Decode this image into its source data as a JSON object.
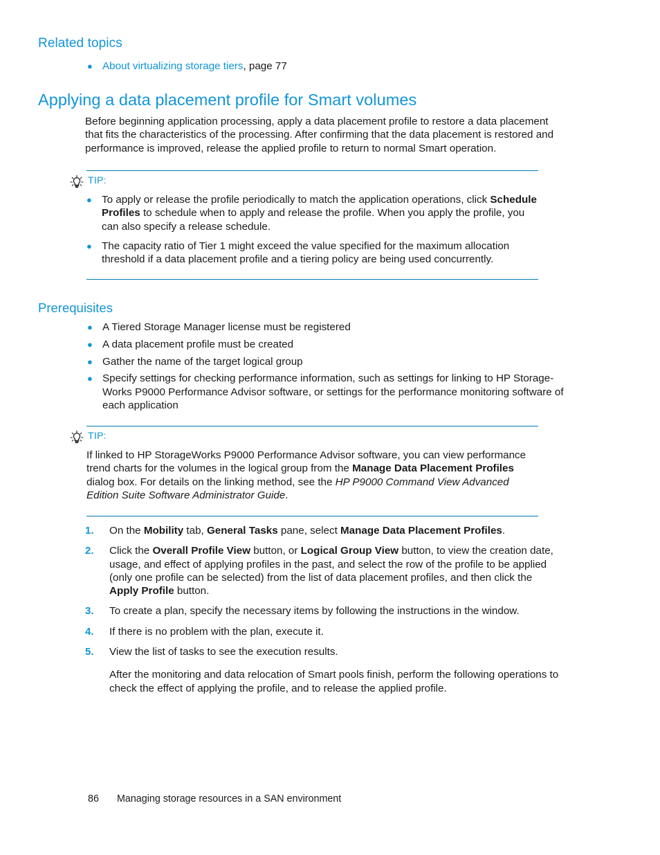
{
  "colors": {
    "heading_blue": "#1295d8",
    "rule_blue": "#0079b4",
    "body_black": "#1a1a1a"
  },
  "related_topics": {
    "heading": "Related topics",
    "items": [
      {
        "link_text": "About virtualizing storage tiers",
        "suffix": ", page 77"
      }
    ]
  },
  "section": {
    "title": "Applying a data placement profile for Smart volumes",
    "intro": "Before beginning application processing, apply a data placement profile to restore a data placement that fits the characteristics of the processing. After confirming that the data placement is restored and performance is improved, release the applied profile to return to normal Smart operation."
  },
  "tip_1": {
    "icon": "lightbulb-icon",
    "label": "TIP:",
    "bullets": [
      {
        "part1": "To apply or release the profile periodically to match the application operations, click ",
        "bold1": "Schedule Profiles",
        "part2": " to schedule when to apply and release the profile. When you apply the profile, you can also specify a release schedule."
      },
      {
        "part1": "The capacity ratio of Tier 1 might exceed the value specified for the maximum allocation threshold if a data placement profile and a tiering policy are being used concurrently.",
        "bold1": "",
        "part2": ""
      }
    ]
  },
  "prerequisites": {
    "heading": "Prerequisites",
    "items": [
      "A Tiered Storage Manager license must be registered",
      "A data placement profile must be created",
      "Gather the name of the target logical group",
      "Specify settings for checking performance information, such as settings for linking to HP Storage-Works P9000 Performance Advisor software, or settings for the performance monitoring software of each application"
    ]
  },
  "tip_2": {
    "icon": "lightbulb-icon",
    "label": "TIP:",
    "paragraph": {
      "part1": "If linked to HP StorageWorks P9000 Performance Advisor software, you can view performance trend charts for the volumes in the logical group from the ",
      "bold1": "Manage Data Placement Profiles",
      "part2": " dialog box. For details on the linking method, see the ",
      "italic1": "HP P9000 Command View Advanced Edition Suite Software Administrator Guide",
      "part3": "."
    }
  },
  "steps": {
    "items": [
      {
        "number": "1.",
        "segments": [
          {
            "text": "On the ",
            "style": "normal"
          },
          {
            "text": "Mobility",
            "style": "bold"
          },
          {
            "text": " tab, ",
            "style": "normal"
          },
          {
            "text": "General Tasks",
            "style": "bold"
          },
          {
            "text": " pane, select ",
            "style": "normal"
          },
          {
            "text": "Manage Data Placement Profiles",
            "style": "bold"
          },
          {
            "text": ".",
            "style": "normal"
          }
        ]
      },
      {
        "number": "2.",
        "segments": [
          {
            "text": "Click the ",
            "style": "normal"
          },
          {
            "text": "Overall Profile View",
            "style": "bold"
          },
          {
            "text": " button, or ",
            "style": "normal"
          },
          {
            "text": "Logical Group View",
            "style": "bold"
          },
          {
            "text": " button, to view the creation date, usage, and effect of applying profiles in the past, and select the row of the profile to be applied (only one profile can be selected) from the list of data placement profiles, and then click the ",
            "style": "normal"
          },
          {
            "text": "Apply Profile",
            "style": "bold"
          },
          {
            "text": " button.",
            "style": "normal"
          }
        ]
      },
      {
        "number": "3.",
        "segments": [
          {
            "text": "To create a plan, specify the necessary items by following the instructions in the window.",
            "style": "normal"
          }
        ]
      },
      {
        "number": "4.",
        "segments": [
          {
            "text": "If there is no problem with the plan, execute it.",
            "style": "normal"
          }
        ]
      },
      {
        "number": "5.",
        "segments": [
          {
            "text": "View the list of tasks to see the execution results.",
            "style": "normal"
          }
        ]
      }
    ],
    "closing": "After the monitoring and data relocation of Smart pools finish, perform the following operations to check the effect of applying the profile, and to release the applied profile."
  },
  "footer": {
    "page_number": "86",
    "chapter_title": "Managing storage resources in a SAN environment"
  }
}
